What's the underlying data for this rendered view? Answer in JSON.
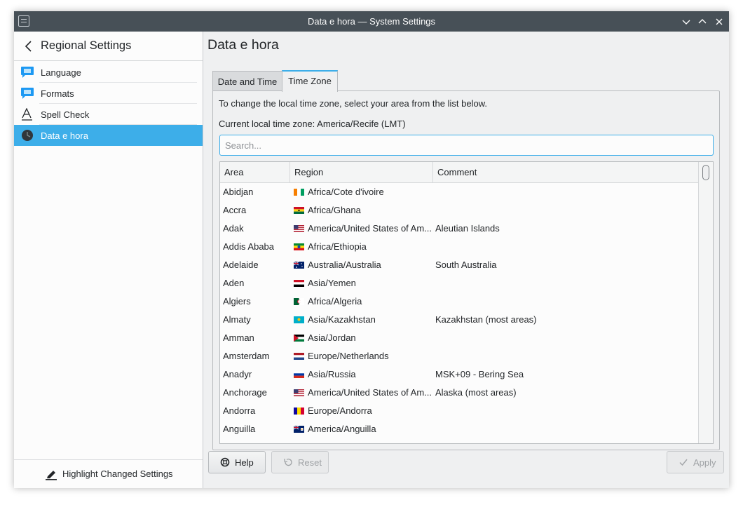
{
  "window": {
    "title": "Data e hora — System Settings"
  },
  "sidebar": {
    "back_title": "Regional Settings",
    "items": [
      {
        "label": "Language",
        "icon": "language-flag-icon"
      },
      {
        "label": "Formats",
        "icon": "formats-flag-icon"
      },
      {
        "label": "Spell Check",
        "icon": "spell-check-icon"
      },
      {
        "label": "Data e hora",
        "icon": "clock-icon",
        "active": true
      }
    ],
    "highlight_label": "Highlight Changed Settings"
  },
  "main": {
    "page_title": "Data e hora",
    "tabs": [
      {
        "label": "Date and Time",
        "active": false
      },
      {
        "label": "Time Zone",
        "active": true
      }
    ],
    "description": "To change the local time zone, select your area from the list below.",
    "current_zone": "Current local time zone: America/Recife (LMT)",
    "search_placeholder": "Search...",
    "table": {
      "headers": [
        "Area",
        "Region",
        "Comment"
      ],
      "rows": [
        {
          "area": "Abidjan",
          "region": "Africa/Cote d'ivoire",
          "comment": "",
          "flag": "ci"
        },
        {
          "area": "Accra",
          "region": "Africa/Ghana",
          "comment": "",
          "flag": "gh"
        },
        {
          "area": "Adak",
          "region": "America/United States of Am...",
          "comment": "Aleutian Islands",
          "flag": "us"
        },
        {
          "area": "Addis Ababa",
          "region": "Africa/Ethiopia",
          "comment": "",
          "flag": "et"
        },
        {
          "area": "Adelaide",
          "region": "Australia/Australia",
          "comment": "South Australia",
          "flag": "au"
        },
        {
          "area": "Aden",
          "region": "Asia/Yemen",
          "comment": "",
          "flag": "ye"
        },
        {
          "area": "Algiers",
          "region": "Africa/Algeria",
          "comment": "",
          "flag": "dz"
        },
        {
          "area": "Almaty",
          "region": "Asia/Kazakhstan",
          "comment": "Kazakhstan (most areas)",
          "flag": "kz"
        },
        {
          "area": "Amman",
          "region": "Asia/Jordan",
          "comment": "",
          "flag": "jo"
        },
        {
          "area": "Amsterdam",
          "region": "Europe/Netherlands",
          "comment": "",
          "flag": "nl"
        },
        {
          "area": "Anadyr",
          "region": "Asia/Russia",
          "comment": "MSK+09 - Bering Sea",
          "flag": "ru"
        },
        {
          "area": "Anchorage",
          "region": "America/United States of Am...",
          "comment": "Alaska (most areas)",
          "flag": "us"
        },
        {
          "area": "Andorra",
          "region": "Europe/Andorra",
          "comment": "",
          "flag": "ad"
        },
        {
          "area": "Anguilla",
          "region": "America/Anguilla",
          "comment": "",
          "flag": "ai"
        }
      ]
    }
  },
  "buttons": {
    "help": "Help",
    "reset": "Reset",
    "apply": "Apply"
  },
  "colors": {
    "accent": "#3daee9",
    "titlebar": "#475057",
    "window_bg": "#eff0f1"
  }
}
